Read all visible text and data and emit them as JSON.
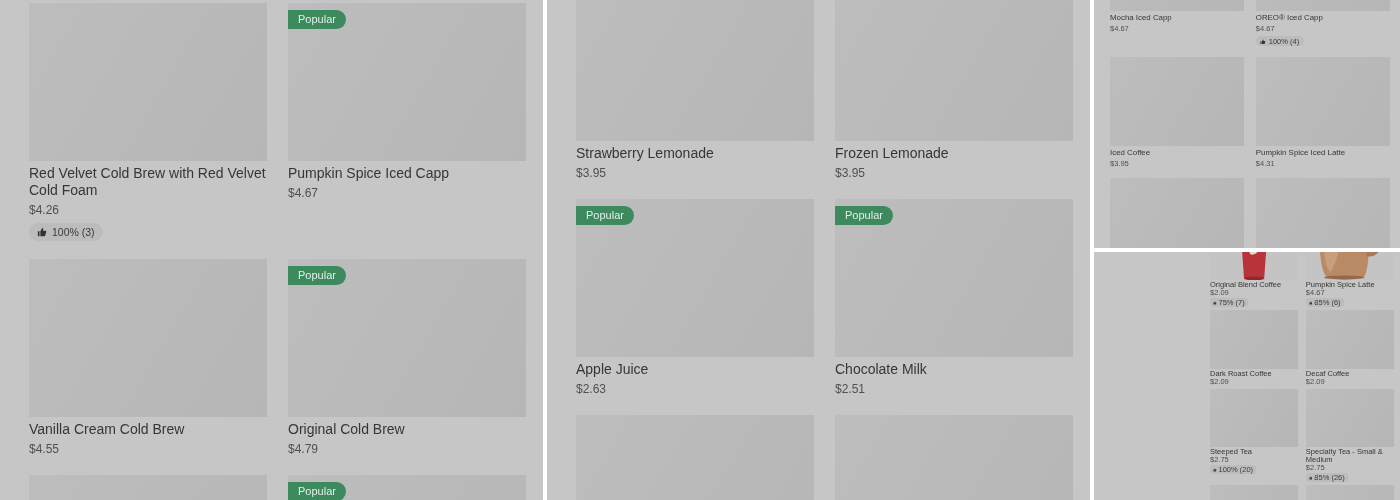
{
  "panels": [
    {
      "products": [
        {
          "name": "Red Velvet Cold Brew with Red Velvet Cold Foam",
          "price": "$4.26",
          "rating": "100% (3)"
        },
        {
          "badge": "Popular",
          "name": "Pumpkin Spice Iced Capp",
          "price": "$4.67"
        },
        {
          "name": "Vanilla Cream Cold Brew",
          "price": "$4.55"
        },
        {
          "badge": "Popular",
          "name": "Original Cold Brew",
          "price": "$4.79"
        },
        {
          "kind": "placeholder"
        },
        {
          "badge": "Popular"
        }
      ]
    },
    {
      "products": [
        {
          "name": "Strawberry Lemonade",
          "price": "$3.95"
        },
        {
          "name": "Frozen Lemonade",
          "price": "$3.95"
        },
        {
          "badge": "Popular",
          "name": "Apple Juice",
          "price": "$2.63"
        },
        {
          "badge": "Popular",
          "name": "Chocolate Milk",
          "price": "$2.51"
        },
        {
          "kind": "placeholder"
        },
        {
          "kind": "placeholder"
        }
      ]
    },
    {
      "products": [
        {
          "name": "Mocha Iced Capp",
          "price": "$4.67"
        },
        {
          "name": "OREO® Iced Capp",
          "price": "$4.67",
          "rating": "100% (4)"
        },
        {
          "name": "Iced Coffee",
          "price": "$3.95"
        },
        {
          "name": "Pumpkin Spice Iced Latte",
          "price": "$4.31"
        },
        {
          "kind": "placeholder"
        },
        {
          "kind": "placeholder"
        }
      ]
    },
    {
      "products": [
        {
          "kind": "picture",
          "name": "Original Blend Coffee",
          "price": "$2.09",
          "rating": "75% (7)"
        },
        {
          "kind": "picture",
          "name": "Pumpkin Spice Latte",
          "price": "$4.67",
          "rating": "85% (6)"
        },
        {
          "name": "Dark Roast Coffee",
          "price": "$2.09"
        },
        {
          "name": "Decaf Coffee",
          "price": "$2.09"
        },
        {
          "name": "Steeped Tea",
          "price": "$2.75",
          "rating": "100% (20)"
        },
        {
          "name": "Specialty Tea - Small & Medium",
          "price": "$2.75",
          "rating": "85% (26)"
        },
        {
          "kind": "placeholder"
        },
        {
          "kind": "placeholder"
        }
      ]
    }
  ]
}
